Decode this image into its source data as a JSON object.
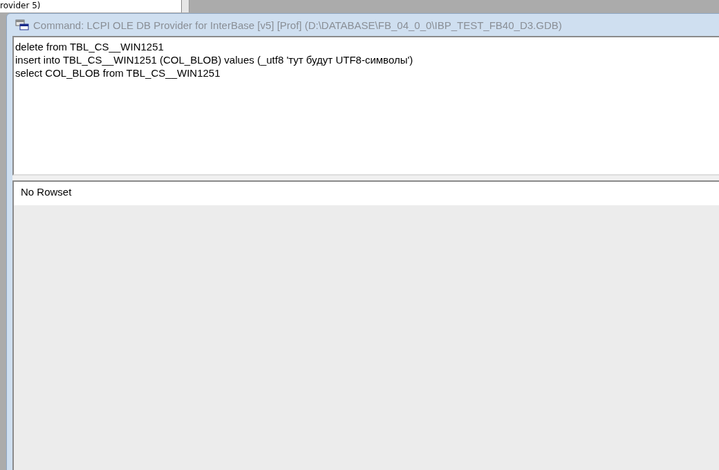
{
  "background_window": {
    "text": "rovider 5)"
  },
  "window": {
    "title": "Command: LCPI OLE DB Provider for InterBase [v5] [Prof] (D:\\DATABASE\\FB_04_0_0\\IBP_TEST_FB40_D3.GDB)",
    "active": false
  },
  "editor": {
    "lines": [
      "delete from TBL_CS__WIN1251",
      "insert into TBL_CS__WIN1251 (COL_BLOB) values (_utf8 'тут будут UTF8-символы')",
      "select COL_BLOB from TBL_CS__WIN1251"
    ]
  },
  "results": {
    "message": "No Rowset"
  }
}
